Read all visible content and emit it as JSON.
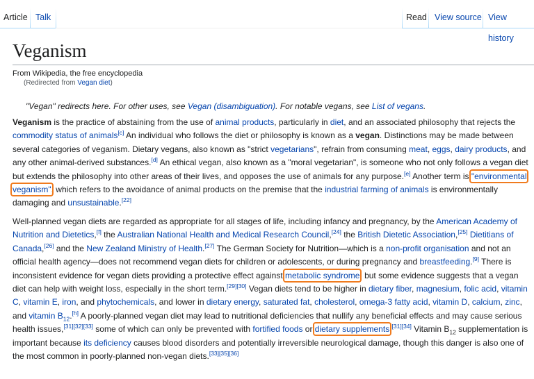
{
  "tabs": {
    "article": "Article",
    "talk": "Talk",
    "read": "Read",
    "view_source": "View source",
    "view_history": "View history"
  },
  "page": {
    "title": "Veganism",
    "site_sub": "From Wikipedia, the free encyclopedia",
    "redirect_prefix": "(Redirected from ",
    "redirect_link": "Vegan diet",
    "redirect_suffix": ")"
  },
  "hatnote": {
    "t1": "\"Vegan\" redirects here. For other uses, see ",
    "l1": "Vegan (disambiguation)",
    "t2": ". For notable vegans, see ",
    "l2": "List of vegans",
    "t3": "."
  },
  "p1": {
    "b1": "Veganism",
    "t1": " is the practice of abstaining from the use of ",
    "l1": "animal products",
    "t2": ", particularly in ",
    "l2": "diet",
    "t3": ", and an associated philosophy that rejects the ",
    "l3": "commodity status of animals",
    "r1": "[c]",
    "t4": " An individual who follows the diet or philosophy is known as a ",
    "b2": "vegan",
    "t5": ". Distinctions may be made between several categories of veganism. Dietary vegans, also known as \"strict ",
    "l4": "vegetarians",
    "t6": "\", refrain from consuming ",
    "l5": "meat",
    "t7": ", ",
    "l6": "eggs",
    "t8": ", ",
    "l7": "dairy products",
    "t9": ", and any other animal-derived substances.",
    "r2": "[d]",
    "t10": " An ethical vegan, also known as a \"moral vegetarian\", is someone who not only follows a vegan diet but extends the philosophy into other areas of their lives, and opposes the use of animals for any purpose.",
    "r3": "[e]",
    "t11": " Another term is ",
    "l8": "\"environmental veganism\"",
    "t12": ", which refers to the avoidance of animal products on the premise that the ",
    "l9": "industrial farming of animals",
    "t13": " is environmentally damaging and ",
    "l10": "unsustainable",
    "t14": ".",
    "r4": "[22]"
  },
  "p2": {
    "t1": "Well-planned vegan diets are regarded as appropriate for all stages of life, including infancy and pregnancy, by the ",
    "l1": "American Academy of Nutrition and Dietetics",
    "t2": ",",
    "r1": "[f]",
    "t3": " the ",
    "l2": "Australian National Health and Medical Research Council",
    "t4": ",",
    "r2": "[24]",
    "t5": " the ",
    "l3": "British Dietetic Association",
    "t6": ",",
    "r3": "[25]",
    "l4": "Dietitians of Canada",
    "t7": ",",
    "r4": "[26]",
    "t8": " and the ",
    "l5": "New Zealand Ministry of Health",
    "t9": ".",
    "r5": "[27]",
    "t10": " The German Society for Nutrition—which is a ",
    "l6": "non-profit organisation",
    "t11": " and not an official health agency—does not recommend vegan diets for children or adolescents, or during pregnancy and ",
    "l7": "breastfeeding",
    "t12": ".",
    "r6": "[9]",
    "t13": " There is inconsistent evidence for vegan diets providing a protective effect against ",
    "l8": "metabolic syndrome",
    "t14": ", but some evidence suggests that a vegan diet can help with weight loss, especially in the short term.",
    "r7": "[29][30]",
    "t15": " Vegan diets tend to be higher in ",
    "l9": "dietary fiber",
    "t16": ", ",
    "l10": "magnesium",
    "t17": ", ",
    "l11": "folic acid",
    "t18": ", ",
    "l12": "vitamin C",
    "t19": ", ",
    "l13": "vitamin E",
    "t20": ", ",
    "l14": "iron",
    "t21": ", and ",
    "l15": "phytochemicals",
    "t22": ", and lower in ",
    "l16": "dietary energy",
    "t23": ", ",
    "l17": "saturated fat",
    "t24": ", ",
    "l18": "cholesterol",
    "t25": ", ",
    "l19": "omega-3 fatty acid",
    "t26": ", ",
    "l20": "vitamin D",
    "t27": ", ",
    "l21": "calcium",
    "t28": ", ",
    "l22": "zinc",
    "t29": ", and ",
    "l23": "vitamin B",
    "l23sub": "12",
    "t30": ".",
    "r8": "[h]",
    "t31": " A poorly-planned vegan diet may lead to nutritional deficiencies that nullify any beneficial effects and may cause serious health issues,",
    "r9": "[31][32][33]",
    "t32": " some of which can only be prevented with ",
    "l24": "fortified foods",
    "t33": " or ",
    "l25": "dietary supplements",
    "t34": ".",
    "r10": "[31][34]",
    "t35": " Vitamin B",
    "t35sub": "12",
    "t36": " supplementation is important because ",
    "l26": "its deficiency",
    "t37": " causes blood disorders and potentially irreversible neurological damage, though this danger is also one of the most common in poorly-planned non-vegan diets.",
    "r11": "[33][35][36]"
  },
  "colors": {
    "link": "#0645ad",
    "text": "#202122",
    "highlight": "#f07b1e",
    "tab_border": "#a7d7f9"
  }
}
